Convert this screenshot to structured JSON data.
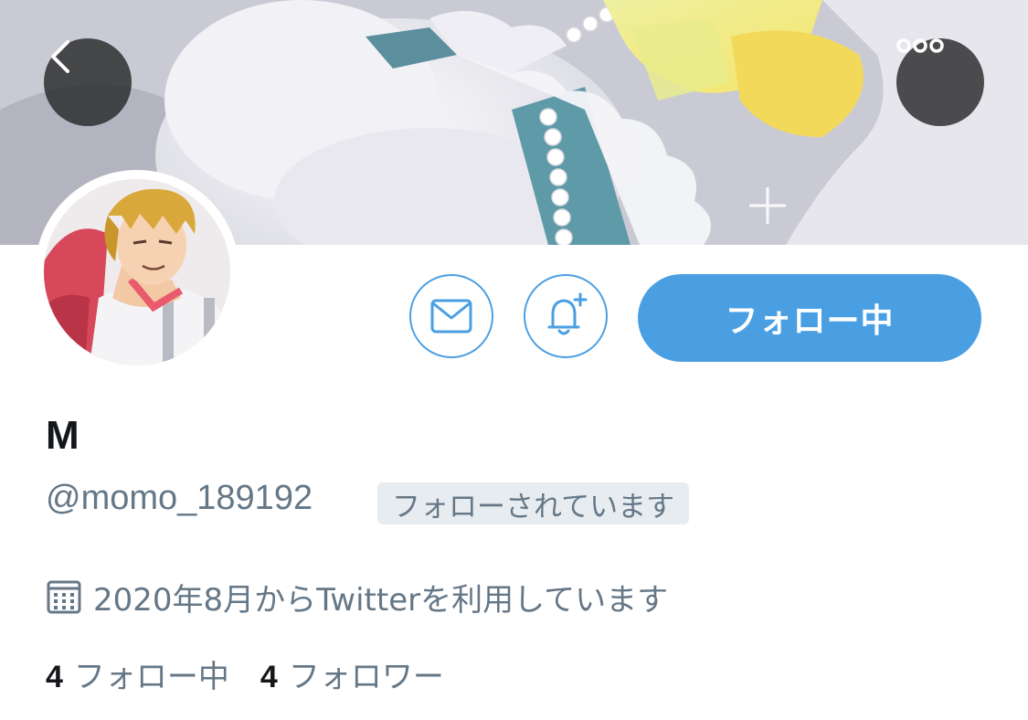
{
  "header": {
    "back_icon": "chevron-left-icon",
    "more_icon": "more-horizontal-icon"
  },
  "actions": {
    "message_icon": "mail-icon",
    "notify_icon": "bell-plus-icon",
    "follow_label": "フォロー中",
    "accent_color": "#4a9fe3"
  },
  "profile": {
    "display_name": "M",
    "handle": "@momo_189192",
    "follows_you_label": "フォローされています",
    "joined_text": "2020年8月からTwitterを利用しています"
  },
  "stats": {
    "following_count": "4",
    "following_label": "フォロー中",
    "followers_count": "4",
    "followers_label": "フォロワー"
  }
}
